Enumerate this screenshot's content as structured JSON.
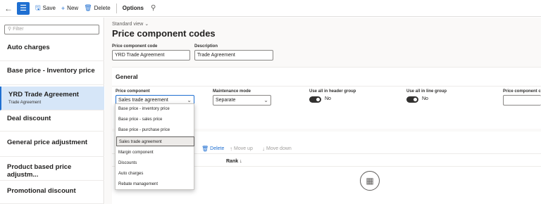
{
  "toolbar": {
    "back_icon": "back-arrow-icon",
    "menu_icon": "hamburger-icon",
    "save": "Save",
    "new": "New",
    "delete": "Delete",
    "options": "Options",
    "search_icon": "search-icon"
  },
  "filter": {
    "placeholder": "Filter"
  },
  "list": [
    {
      "title": "Auto charges",
      "sub": ""
    },
    {
      "title": "Base price - Inventory price",
      "sub": ""
    },
    {
      "title": "YRD Trade Agreement",
      "sub": "Trade Agreement"
    },
    {
      "title": "Deal discount",
      "sub": ""
    },
    {
      "title": "General price adjustment",
      "sub": ""
    },
    {
      "title": "Product based price adjustm...",
      "sub": ""
    },
    {
      "title": "Promotional discount",
      "sub": ""
    }
  ],
  "main": {
    "view": "Standard view",
    "title": "Price component codes",
    "code_label": "Price component code",
    "code_value": "YRD Trade Agreement",
    "desc_label": "Description",
    "desc_value": "Trade Agreement"
  },
  "general": {
    "title": "General",
    "pc_label": "Price component",
    "pc_value": "Sales trade agreement",
    "mm_label": "Maintenance mode",
    "mm_value": "Separate",
    "hdr_label": "Use all in header group",
    "hdr_value": "No",
    "line_label": "Use all in line group",
    "line_value": "No",
    "pcc_label": "Price component c"
  },
  "grid": {
    "add_partial": "p",
    "delete": "Delete",
    "move_up": "Move up",
    "move_down": "Move down",
    "rank_header": "Rank",
    "empty_icon": "empty-box-icon"
  },
  "dropdown": [
    "Base price - inventory price",
    "Base price - sales price",
    "Base price - purchase price",
    "Sales trade agreement",
    "Margin component",
    "Discounts",
    "Auto charges",
    "Rebate management"
  ],
  "colors": {
    "accent": "#1f6fd1",
    "selected_bg": "#d6e6f8"
  }
}
